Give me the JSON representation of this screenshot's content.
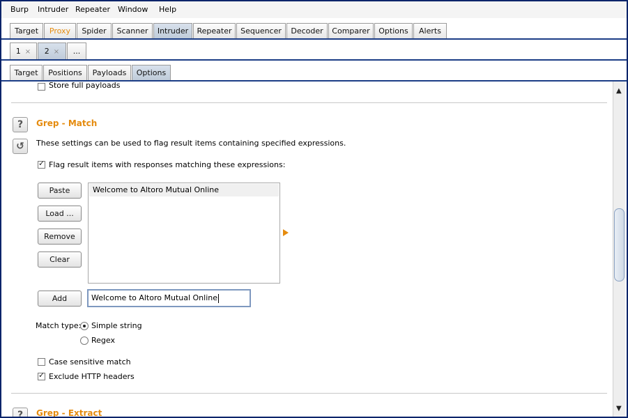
{
  "menu": [
    "Burp",
    "Intruder",
    "Repeater",
    "Window",
    "Help"
  ],
  "main_tabs": [
    "Target",
    "Proxy",
    "Spider",
    "Scanner",
    "Intruder",
    "Repeater",
    "Sequencer",
    "Decoder",
    "Comparer",
    "Options",
    "Alerts"
  ],
  "attack_tabs": {
    "tab1": "1",
    "tab2": "2",
    "more": "...",
    "close_glyph": "×"
  },
  "sub_tabs": [
    "Target",
    "Positions",
    "Payloads",
    "Options"
  ],
  "prev_section": {
    "store_full_payloads": "Store full payloads",
    "checked": false
  },
  "grep_match": {
    "title": "Grep - Match",
    "help_glyph": "?",
    "reset_glyph": "↺",
    "description": "These settings can be used to flag result items containing specified expressions.",
    "flag_label": "Flag result items with responses matching these expressions:",
    "flag_checked": true,
    "buttons": {
      "paste": "Paste",
      "load": "Load ...",
      "remove": "Remove",
      "clear": "Clear",
      "add": "Add"
    },
    "list_items": [
      "Welcome to Altoro Mutual Online"
    ],
    "input_value": "Welcome to Altoro Mutual Online",
    "match_type_label": "Match type:",
    "match_type_options": [
      "Simple string",
      "Regex"
    ],
    "match_type_selected": "Simple string",
    "case_sensitive_label": "Case sensitive match",
    "case_sensitive_checked": false,
    "exclude_headers_label": "Exclude HTTP headers",
    "exclude_headers_checked": true
  },
  "grep_extract": {
    "title": "Grep - Extract",
    "help_glyph": "?"
  },
  "scrollbar": {
    "up_glyph": "▲",
    "down_glyph": "▼"
  },
  "colors": {
    "accent_orange": "#e58b0e",
    "border_blue": "#1b3d86",
    "selected_tab": "#c8d3e0"
  }
}
